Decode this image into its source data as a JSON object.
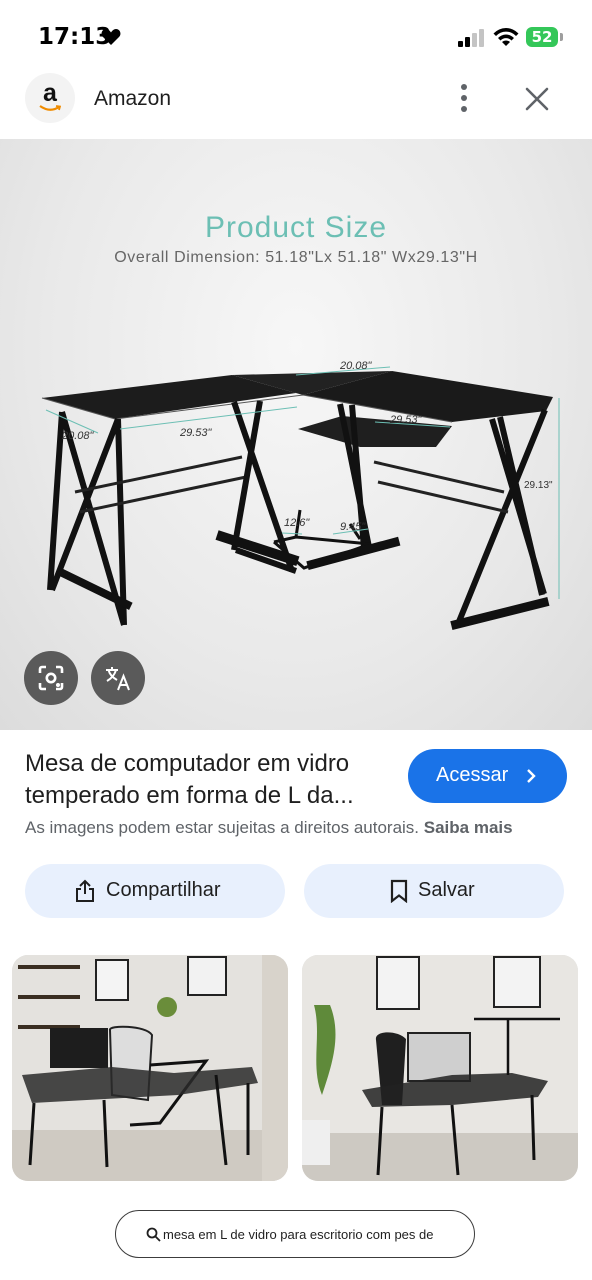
{
  "status_bar": {
    "time": "17:13",
    "battery": "52"
  },
  "header": {
    "site_name": "Amazon",
    "logo_letter": "a"
  },
  "product_image": {
    "heading": "Product Size",
    "overall_dimension": "Overall Dimension: 51.18\"Lx 51.18\" Wx29.13\"H",
    "dimensions": {
      "top_width": "20.08\"",
      "left_depth": "20.08\"",
      "left_length": "29.53\"",
      "right_length": "29.53\"",
      "height": "29.13\"",
      "shelf_width": "12.6\"",
      "shelf_depth": "9.45\""
    }
  },
  "result": {
    "title": "Mesa de computador em vidro temperado em forma de L da...",
    "visit_label": "Acessar",
    "copyright": "As imagens podem estar sujeitas a direitos autorais.",
    "learn_more": "Saiba mais"
  },
  "actions": {
    "share_label": "Compartilhar",
    "save_label": "Salvar"
  },
  "search": {
    "query": "mesa em L de vidro para escritorio com pes de"
  },
  "colors": {
    "accent": "#1a73e8",
    "pill_bg": "#e8f0fd",
    "heading_teal": "#6cbfb4",
    "battery_green": "#34c759"
  },
  "icons": [
    "heart-icon",
    "signal-icon",
    "wifi-icon",
    "battery-icon",
    "more-vert-icon",
    "close-icon",
    "lens-icon",
    "translate-icon",
    "chevron-right-icon",
    "share-icon",
    "bookmark-icon",
    "search-icon"
  ]
}
